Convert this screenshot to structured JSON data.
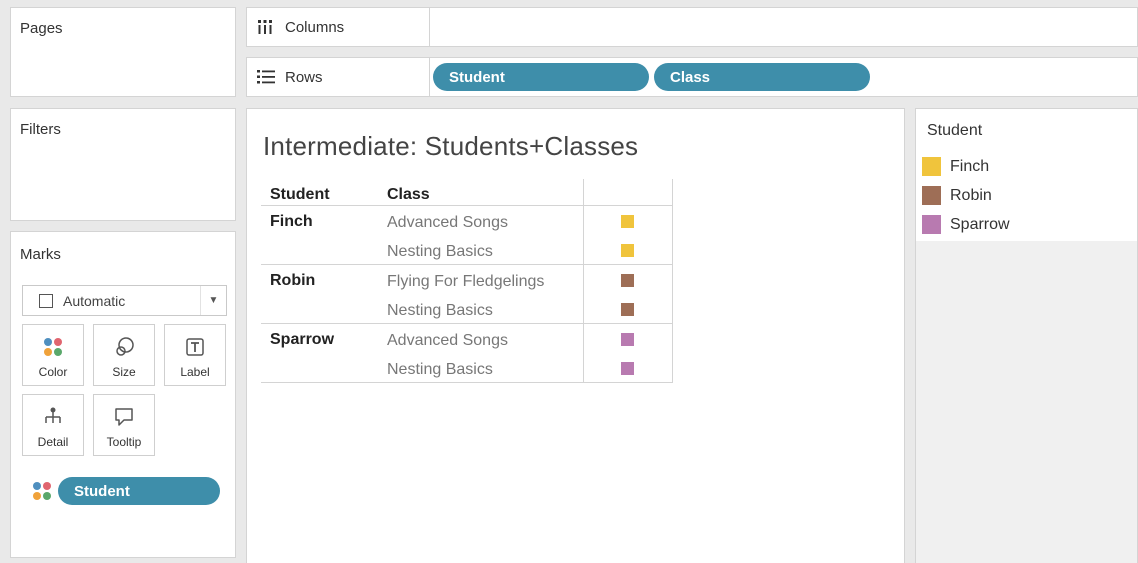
{
  "cards": {
    "pages": "Pages",
    "filters": "Filters",
    "marks": "Marks"
  },
  "shelves": {
    "columns_label": "Columns",
    "rows_label": "Rows",
    "rows_pills": [
      "Student",
      "Class"
    ]
  },
  "marks": {
    "type": "Automatic",
    "buttons": [
      "Color",
      "Size",
      "Label",
      "Detail",
      "Tooltip"
    ],
    "color_pill": "Student"
  },
  "viz": {
    "title": "Intermediate: Students+Classes",
    "headers": [
      "Student",
      "Class"
    ],
    "groups": [
      {
        "student": "Finch",
        "classes": [
          "Advanced Songs",
          "Nesting Basics"
        ],
        "color": "#f0c43c"
      },
      {
        "student": "Robin",
        "classes": [
          "Flying For Fledgelings",
          "Nesting Basics"
        ],
        "color": "#9e6e56"
      },
      {
        "student": "Sparrow",
        "classes": [
          "Advanced Songs",
          "Nesting Basics"
        ],
        "color": "#b87ab0"
      }
    ]
  },
  "legend": {
    "title": "Student",
    "items": [
      {
        "label": "Finch",
        "color": "#f0c43c"
      },
      {
        "label": "Robin",
        "color": "#9e6e56"
      },
      {
        "label": "Sparrow",
        "color": "#b87ab0"
      }
    ]
  }
}
